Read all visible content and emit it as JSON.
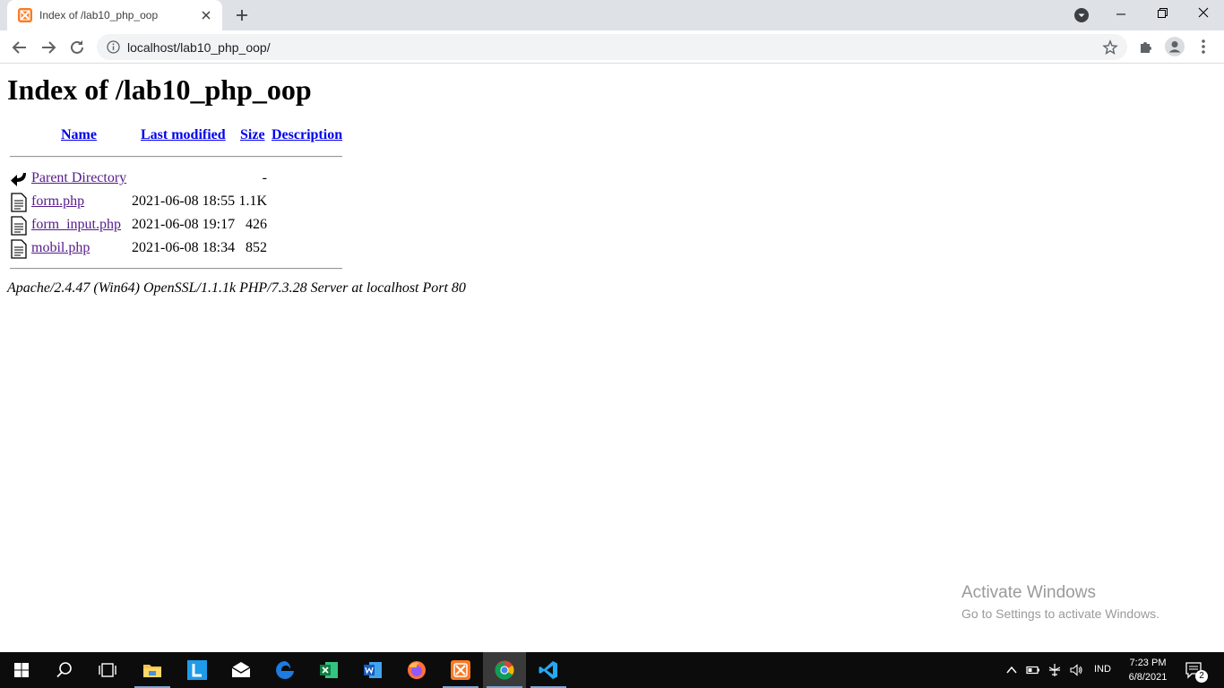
{
  "browser": {
    "tab_title": "Index of /lab10_php_oop",
    "url": "localhost/lab10_php_oop/"
  },
  "page": {
    "title": "Index of /lab10_php_oop",
    "columns": {
      "name": "Name",
      "last_modified": "Last modified",
      "size": "Size",
      "description": "Description"
    },
    "rows": [
      {
        "name": "Parent Directory",
        "modified": "",
        "size": "-",
        "icon": "back-arrow-icon"
      },
      {
        "name": "form.php",
        "modified": "2021-06-08 18:55",
        "size": "1.1K",
        "icon": "file-icon"
      },
      {
        "name": "form_input.php",
        "modified": "2021-06-08 19:17",
        "size": "426",
        "icon": "file-icon"
      },
      {
        "name": "mobil.php",
        "modified": "2021-06-08 18:34",
        "size": "852",
        "icon": "file-icon"
      }
    ],
    "server_signature": "Apache/2.4.47 (Win64) OpenSSL/1.1.1k PHP/7.3.28 Server at localhost Port 80"
  },
  "watermark": {
    "line1": "Activate Windows",
    "line2": "Go to Settings to activate Windows."
  },
  "taskbar": {
    "apps": [
      "start",
      "search",
      "task-view",
      "file-explorer",
      "lightshot",
      "mail",
      "edge",
      "excel",
      "word",
      "firefox",
      "xampp",
      "chrome",
      "vscode"
    ],
    "active_app": "chrome",
    "language": "IND",
    "time": "7:23 PM",
    "date": "6/8/2021",
    "notification_count": "2"
  },
  "colors": {
    "link": "#0000ee",
    "visited_link": "#551a8b",
    "tab_strip": "#dee1e6",
    "taskbar": "#0c0c0c"
  }
}
